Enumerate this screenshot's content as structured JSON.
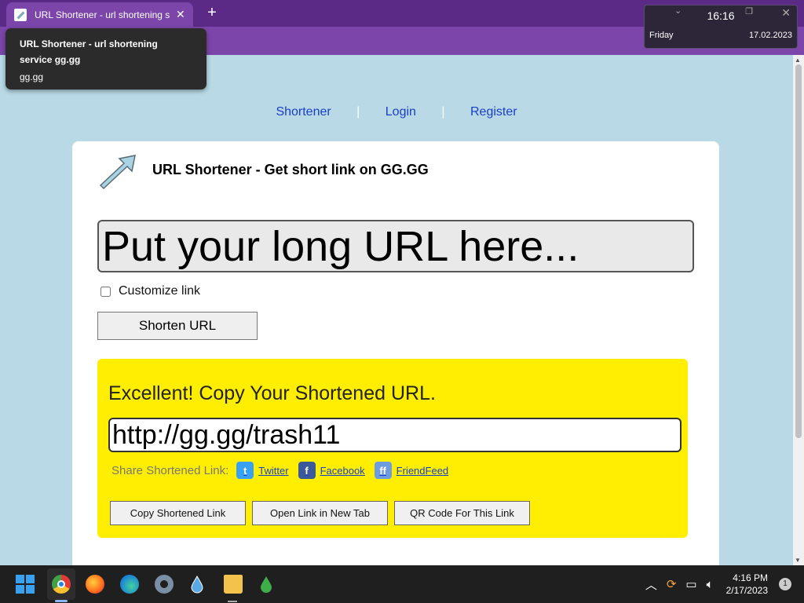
{
  "browser": {
    "tab_title": "URL Shortener - url shortening se",
    "tooltip_title": "URL Shortener - url shortening service gg.gg",
    "tooltip_url": "gg.gg",
    "new_tab_icon": "plus-icon",
    "close_icon": "close-icon"
  },
  "clock_widget": {
    "time": "16:16",
    "day": "Friday",
    "date": "17.02.2023"
  },
  "nav": {
    "items": [
      "Shortener",
      "Login",
      "Register"
    ],
    "separator": "|"
  },
  "card": {
    "title": "URL Shortener - Get short link on GG.GG",
    "url_placeholder": "Put your long URL here...",
    "customize_label": "Customize link",
    "customize_checked": false,
    "shorten_label": "Shorten URL"
  },
  "result": {
    "heading": "Excellent! Copy Your Shortened URL.",
    "short_url": "http://gg.gg/trash11",
    "share_label": "Share Shortened Link:",
    "share_links": [
      "Twitter",
      "Facebook",
      "FriendFeed"
    ],
    "buttons": [
      "Copy Shortened Link",
      "Open Link in New Tab",
      "QR Code For This Link"
    ],
    "background_color": "#ffee00"
  },
  "taskbar": {
    "time": "4:16 PM",
    "date": "2/17/2023",
    "notification_count": "1"
  },
  "colors": {
    "page_bg": "#b9d9e6",
    "browser_frame": "#5b2a86",
    "link": "#1a3fc7"
  }
}
